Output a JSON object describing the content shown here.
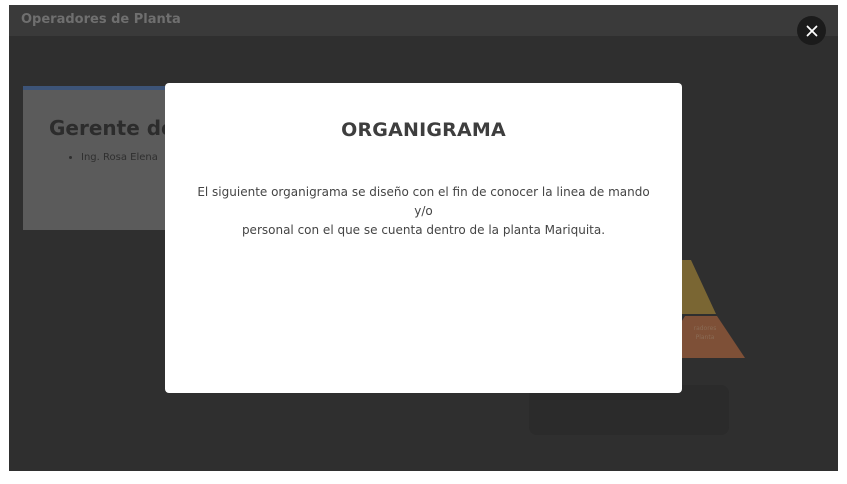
{
  "header": {
    "title": "Operadores de Planta"
  },
  "background_card": {
    "title": "Gerente de Z",
    "items": [
      "Ing. Rosa Elena"
    ]
  },
  "pyramid": {
    "label_line1": "radores",
    "label_line2": "Planta"
  },
  "modal": {
    "title": "ORGANIGRAMA",
    "description_line1": "El siguiente organigrama se diseño con el fin de conocer la linea de mando y/o",
    "description_line2": "personal con el que se cuenta dentro de la planta Mariquita."
  },
  "close_icon": "close-icon"
}
